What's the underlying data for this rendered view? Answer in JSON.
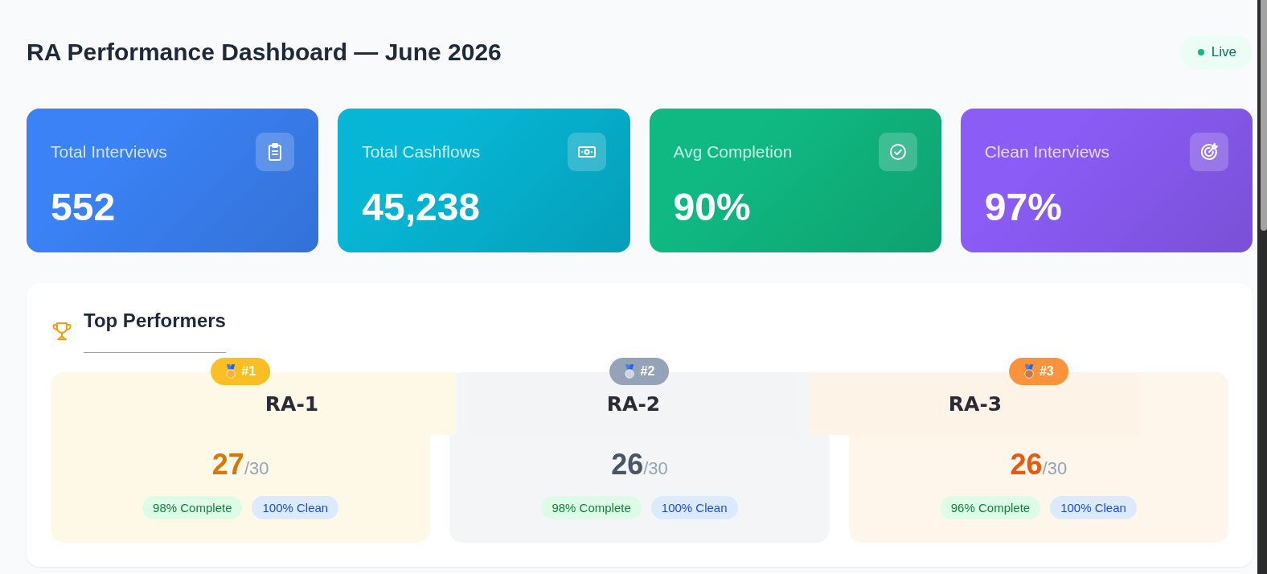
{
  "header": {
    "title": "RA Performance Dashboard — June 2026",
    "status": "Live"
  },
  "stats": [
    {
      "label": "Total Interviews",
      "value": "552",
      "color": "#3b82f6"
    },
    {
      "label": "Total Cashflows",
      "value": "45,238",
      "color": "#06b6d4"
    },
    {
      "label": "Avg Completion",
      "value": "90%",
      "color": "#10b981"
    },
    {
      "label": "Clean Interviews",
      "value": "97%",
      "color": "#8b5cf6"
    }
  ],
  "top_performers": {
    "title": "Top Performers",
    "performers": [
      {
        "kind": "gold",
        "rank": "#1",
        "name": "RA-1",
        "score": "27",
        "total": "/30",
        "completion": "98% Complete",
        "clean": "100% Clean"
      },
      {
        "kind": "silver",
        "rank": "#2",
        "name": "RA-2",
        "score": "26",
        "total": "/30",
        "completion": "98% Complete",
        "clean": "100% Clean"
      },
      {
        "kind": "bronze",
        "rank": "#3",
        "name": "RA-3",
        "score": "26",
        "total": "/30",
        "completion": "96% Complete",
        "clean": "100% Clean"
      }
    ]
  }
}
